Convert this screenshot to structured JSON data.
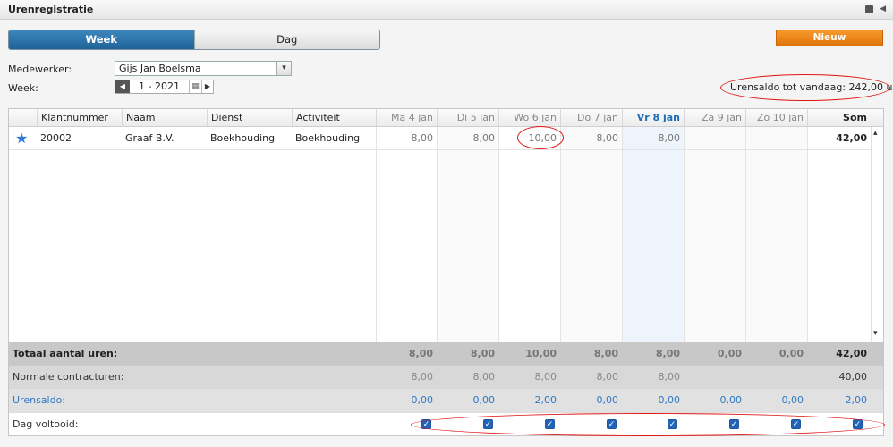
{
  "window": {
    "title": "Urenregistratie",
    "menu_icon": "square-icon",
    "collapse_icon": "triangle-left-icon"
  },
  "view_toggle": {
    "week_label": "Week",
    "dag_label": "Dag",
    "selected": "Week"
  },
  "new_button": {
    "label": "Nieuw"
  },
  "filters": {
    "medewerker_label": "Medewerker:",
    "medewerker_value": "Gijs Jan Boelsma",
    "week_label": "Week:",
    "week_value": "1 - 2021"
  },
  "saldo_text": "Urensaldo tot vandaag: 242,00 u",
  "table": {
    "headers": {
      "klantnummer": "Klantnummer",
      "naam": "Naam",
      "dienst": "Dienst",
      "activiteit": "Activiteit",
      "days": [
        "Ma 4 jan",
        "Di 5 jan",
        "Wo 6 jan",
        "Do 7 jan",
        "Vr 8 jan",
        "Za 9 jan",
        "Zo 10 jan"
      ],
      "som": "Som"
    },
    "today_index": 4,
    "rows": [
      {
        "favorite_icon": "star-icon",
        "klantnummer": "20002",
        "naam": "Graaf B.V.",
        "dienst": "Boekhouding",
        "activiteit": "Boekhouding",
        "days": [
          "8,00",
          "8,00",
          "10,00",
          "8,00",
          "8,00",
          "",
          ""
        ],
        "som": "42,00"
      }
    ],
    "totals": {
      "totaal": {
        "label": "Totaal aantal uren:",
        "days": [
          "8,00",
          "8,00",
          "10,00",
          "8,00",
          "8,00",
          "0,00",
          "0,00"
        ],
        "som": "42,00"
      },
      "normaal": {
        "label": "Normale contracturen:",
        "days": [
          "8,00",
          "8,00",
          "8,00",
          "8,00",
          "8,00",
          "",
          ""
        ],
        "som": "40,00"
      },
      "saldo": {
        "label": "Urensaldo:",
        "days": [
          "0,00",
          "0,00",
          "2,00",
          "0,00",
          "0,00",
          "0,00",
          "0,00"
        ],
        "som": "2,00"
      },
      "voltooid": {
        "label": "Dag voltooid:",
        "checked": [
          true,
          true,
          true,
          true,
          true,
          true,
          true,
          true
        ]
      }
    }
  },
  "colors": {
    "accent_blue": "#1f6498",
    "orange": "#e0740c",
    "annotation_red": "#e01414",
    "saldo_blue": "#2f78c4"
  }
}
